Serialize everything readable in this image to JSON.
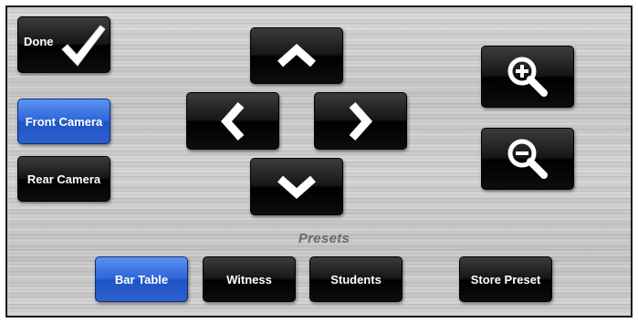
{
  "done_button": {
    "label": "Done",
    "icon": "checkmark-icon"
  },
  "cameras": {
    "front": {
      "label": "Front Camera",
      "active": true
    },
    "rear": {
      "label": "Rear Camera",
      "active": false
    }
  },
  "pan_tilt": {
    "up_icon": "chevron-up-icon",
    "down_icon": "chevron-down-icon",
    "left_icon": "chevron-left-icon",
    "right_icon": "chevron-right-icon"
  },
  "zoom": {
    "in_icon": "zoom-in-icon",
    "out_icon": "zoom-out-icon"
  },
  "presets": {
    "title": "Presets",
    "items": [
      {
        "label": "Bar Table",
        "active": true
      },
      {
        "label": "Witness",
        "active": false
      },
      {
        "label": "Students",
        "active": false
      }
    ],
    "store_label": "Store Preset"
  },
  "colors": {
    "active_button": "#2d66d9",
    "inactive_button": "#111111",
    "presets_label": "#6a6a6a"
  }
}
